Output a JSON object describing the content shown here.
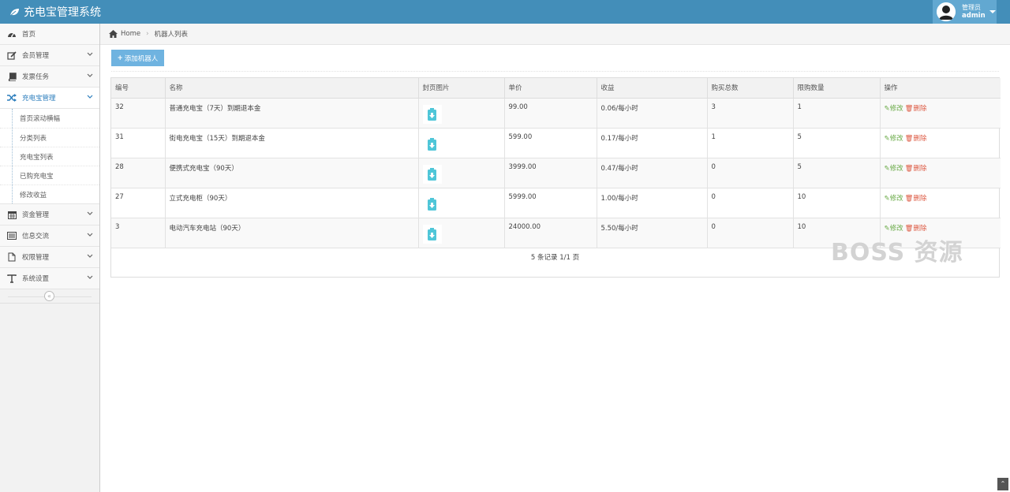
{
  "app": {
    "title": "充电宝管理系统"
  },
  "user": {
    "role": "管理员",
    "name": "admin"
  },
  "sidebar": {
    "items": [
      {
        "label": "首页",
        "icon": "dashboard-icon",
        "has_submenu": false
      },
      {
        "label": "会员管理",
        "icon": "edit-icon",
        "has_submenu": true
      },
      {
        "label": "发票任务",
        "icon": "book-icon",
        "has_submenu": true
      },
      {
        "label": "充电宝管理",
        "icon": "shuffle-icon",
        "has_submenu": true,
        "active": true
      },
      {
        "label": "资金管理",
        "icon": "calendar-icon",
        "has_submenu": true
      },
      {
        "label": "信息交流",
        "icon": "list-icon",
        "has_submenu": true
      },
      {
        "label": "权限管理",
        "icon": "file-icon",
        "has_submenu": true
      },
      {
        "label": "系统设置",
        "icon": "text-icon",
        "has_submenu": true
      }
    ],
    "submenu": [
      "首页滚动横幅",
      "分类列表",
      "充电宝列表",
      "已购充电宝",
      "修改收益"
    ]
  },
  "breadcrumb": {
    "home": "Home",
    "current": "机器人列表"
  },
  "toolbar": {
    "add_label": "添加机器人"
  },
  "table": {
    "headers": [
      "编号",
      "名称",
      "封页图片",
      "单价",
      "收益",
      "购买总数",
      "限购数量",
      "操作"
    ],
    "rows": [
      {
        "id": "32",
        "name": "普通充电宝（7天）到期退本金",
        "price": "99.00",
        "income": "0.06/每小时",
        "total": "3",
        "limit": "1"
      },
      {
        "id": "31",
        "name": "街电充电宝（15天）到期退本金",
        "price": "599.00",
        "income": "0.17/每小时",
        "total": "1",
        "limit": "5"
      },
      {
        "id": "28",
        "name": "便携式充电宝（90天）",
        "price": "3999.00",
        "income": "0.47/每小时",
        "total": "0",
        "limit": "5"
      },
      {
        "id": "27",
        "name": "立式充电柜（90天）",
        "price": "5999.00",
        "income": "1.00/每小时",
        "total": "0",
        "limit": "10"
      },
      {
        "id": "3",
        "name": "电动汽车充电站（90天）",
        "price": "24000.00",
        "income": "5.50/每小时",
        "total": "0",
        "limit": "10"
      }
    ],
    "edit_label": "修改",
    "delete_label": "删除",
    "pager": "5 条记录 1/1 页"
  },
  "watermark": "BOSS 资源",
  "colors": {
    "header": "#438eb9",
    "user_box": "#62a8d1",
    "add_button": "#6fb3e0",
    "edit": "#69aa46",
    "delete": "#dd5a43",
    "thumb_icon": "#4fc6d8"
  }
}
